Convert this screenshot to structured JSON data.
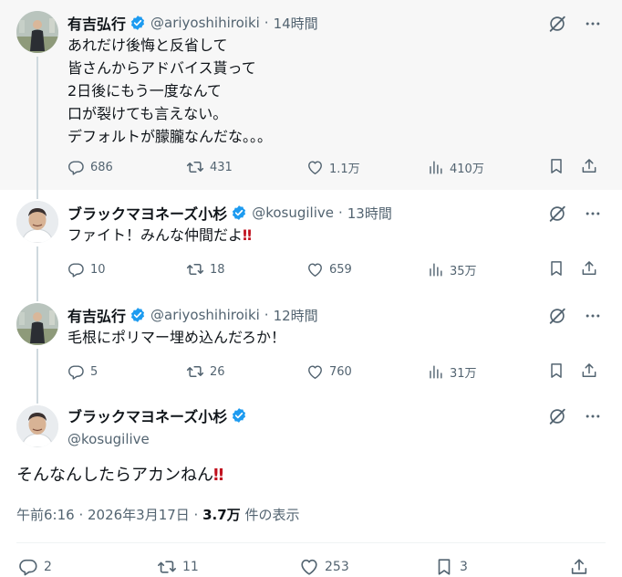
{
  "colors": {
    "text": "#0f1419",
    "muted": "#536471",
    "verified": "#1d9bf0",
    "line": "#cfd9de",
    "highlight": "#f7f7f7",
    "alert": "#c1121f"
  },
  "icons": {
    "reply": "reply-icon",
    "repost": "repost-icon",
    "like": "heart-icon",
    "views": "views-icon",
    "bookmark": "bookmark-icon",
    "share": "share-icon",
    "grok": "grok-icon",
    "more": "more-icon",
    "verified": "verified-badge-icon"
  },
  "tweets": [
    {
      "name": "有吉弘行",
      "handle": "@ariyoshihiroiki",
      "time": "14時間",
      "lines": [
        "あれだけ後悔と反省して",
        "皆さんからアドバイス貰って",
        "2日後にもう一度なんて",
        "口が裂けても言えない。",
        "デフォルトが朦朧なんだな。。。"
      ],
      "replies": "686",
      "reposts": "431",
      "likes": "1.1万",
      "views": "410万"
    },
    {
      "name": "ブラックマヨネーズ小杉",
      "handle": "@kosugilive",
      "time": "13時間",
      "text": "ファイト！みんな仲間だよ",
      "emoji": "‼",
      "replies": "10",
      "reposts": "18",
      "likes": "659",
      "views": "35万"
    },
    {
      "name": "有吉弘行",
      "handle": "@ariyoshihiroiki",
      "time": "12時間",
      "text": "毛根にポリマー埋め込んだろか！",
      "replies": "5",
      "reposts": "26",
      "likes": "760",
      "views": "31万"
    }
  ],
  "main": {
    "name": "ブラックマヨネーズ小杉",
    "handle": "@kosugilive",
    "text": "そんなんしたらアカンねん",
    "emoji": "‼",
    "timestamp": "午前6:16 · 2026年3月17日 · ",
    "views_count": "3.7万",
    "views_label": " 件の表示",
    "replies": "2",
    "reposts": "11",
    "likes": "253",
    "bookmarks": "3"
  }
}
